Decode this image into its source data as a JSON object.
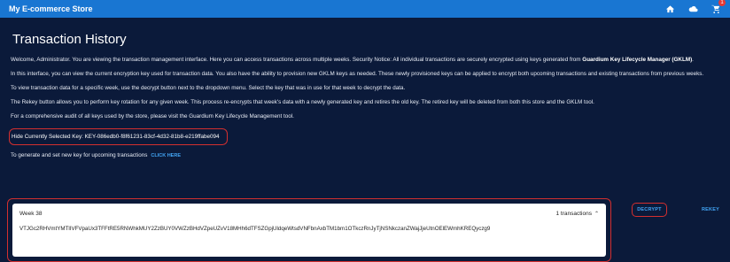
{
  "app": {
    "title": "My E-commerce Store",
    "cart_count": "1"
  },
  "page": {
    "title": "Transaction History",
    "intro_1": "Welcome, Administrator. You are viewing the transaction management interface. Here you can access transactions across multiple weeks. Security Notice: All individual transactions are securely encrypted using keys generated from ",
    "intro_bold": "Guardium Key Lifecycle Manager (GKLM)",
    "intro_end": ".",
    "para_2": "In this interface, you can view the current encryption key used for transaction data. You also have the ability to provision new GKLM keys as needed. These newly provisioned keys can be applied to encrypt both upcoming transactions and existing transactions from previous weeks.",
    "para_3": "To view transaction data for a specific week, use the decrypt button next to the dropdown menu. Select the key that was in use for that week to decrypt the data.",
    "para_4": "The Rekey button allows you to perform key rotation for any given week. This process re-encrypts that week's data with a newly generated key and retires the old key. The retired key will be deleted from both this store and the GKLM tool.",
    "para_5": "For a comprehensive audit of all keys used by the store, please visit the Guardium Key Lifecycle Management tool.",
    "key_label": "Hide Currently Selected Key: KEY-086edb0-f8f61231-83cf-4d32-81b8-e219ffabe094",
    "generate_text": "To generate and set new key for upcoming transactions",
    "click_here": "CLICK HERE"
  },
  "week": {
    "title": "Week 38",
    "count": "1 transactions",
    "cipher": "VTJGc2RHVmtYMTlIVFVpaUx3TFFtRE5RNWhkMUY2ZzBUY0VWZzBHdVZpeUZvV18MHh6dTFSZGpjUldqeWtsdVNFbnAxbTM1bm1OTkczRnJyTjNSNkczanZWajJjeUtnOElEWmhKREQyczg9"
  },
  "actions": {
    "decrypt": "DECRYPT",
    "rekey": "REKEY"
  }
}
